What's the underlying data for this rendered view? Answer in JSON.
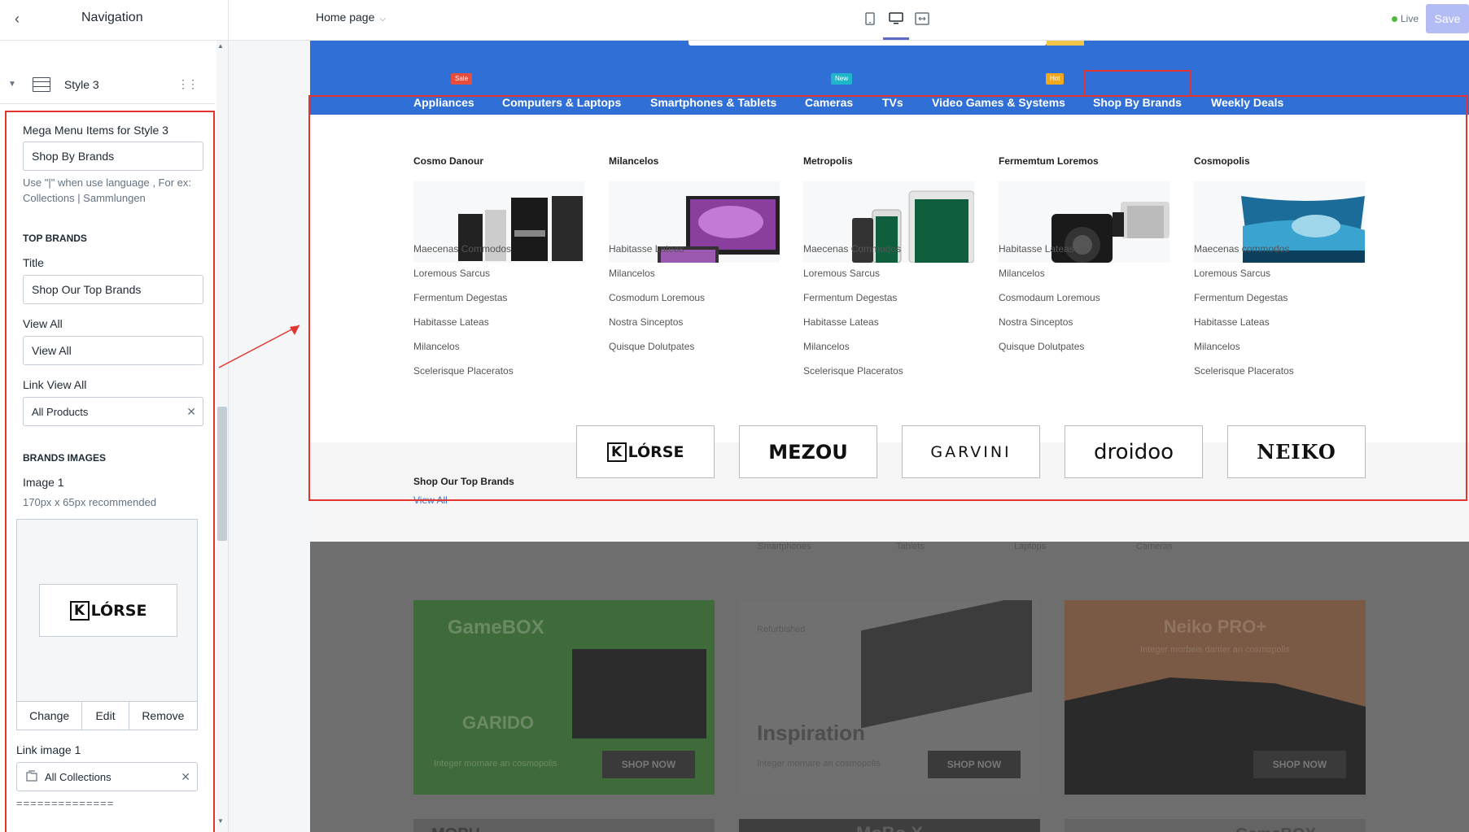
{
  "topbar": {
    "section_title": "Navigation",
    "page_selector": "Home page",
    "live_label": "Live",
    "save_label": "Save"
  },
  "sidebar": {
    "style_label": "Style 3",
    "mega_items_label": "Mega Menu Items for Style 3",
    "mega_items_value": "Shop By Brands",
    "mega_items_help": "Use \"|\" when use language , For ex: Collections | Sammlungen",
    "top_brands_heading": "TOP BRANDS",
    "title_label": "Title",
    "title_value": "Shop Our Top Brands",
    "view_all_label": "View All",
    "view_all_value": "View All",
    "link_view_all_label": "Link View All",
    "link_view_all_value": "All Products",
    "brand_images_heading": "BRANDS IMAGES",
    "image1_label": "Image 1",
    "image1_help": "170px x 65px recommended",
    "image_actions": [
      "Change",
      "Edit",
      "Remove"
    ],
    "link_image1_label": "Link image 1",
    "link_image1_value": "All Collections",
    "separator": "=============="
  },
  "store_nav": {
    "items": [
      "Appliances",
      "Computers & Laptops",
      "Smartphones & Tablets",
      "Cameras",
      "TVs",
      "Video Games & Systems",
      "Shop By Brands",
      "Weekly Deals"
    ],
    "badges": {
      "sale": "Sale",
      "new": "New",
      "hot": "Hot"
    },
    "badge_colors": {
      "sale": "#e74c3c",
      "new": "#1fb6c9",
      "hot": "#f0a81e"
    }
  },
  "mega_menu": {
    "columns": [
      {
        "title": "Cosmo Danour",
        "links": [
          "Maecenas Commodos",
          "Loremous Sarcus",
          "Fermentum Degestas",
          "Habitasse Lateas",
          "Milancelos",
          "Scelerisque Placeratos"
        ]
      },
      {
        "title": "Milancelos",
        "links": [
          "Habitasse Lateas",
          "Milancelos",
          "Cosmodum Loremous",
          "Nostra Sinceptos",
          "Quisque Dolutpates"
        ]
      },
      {
        "title": "Metropolis",
        "links": [
          "Maecenas Commodos",
          "Loremous Sarcus",
          "Fermentum Degestas",
          "Habitasse Lateas",
          "Milancelos",
          "Scelerisque Placeratos"
        ]
      },
      {
        "title": "Fermemtum Loremos",
        "links": [
          "Habitasse Lateas",
          "Milancelos",
          "Cosmodaum Loremous",
          "Nostra Sinceptos",
          "Quisque Dolutpates"
        ]
      },
      {
        "title": "Cosmopolis",
        "links": [
          "Maecenas commodos",
          "Loremous Sarcus",
          "Fermentum Degestas",
          "Habitasse Lateas",
          "Milancelos",
          "Scelerisque Placeratos"
        ]
      }
    ],
    "top_brands_title": "Shop Our Top Brands",
    "view_all": "View All",
    "brands": [
      "KLÓRSE",
      "MEZOU",
      "GARVINI",
      "droidoo",
      "NEIKO"
    ]
  },
  "below": {
    "category_labels": [
      "Smartphones",
      "Tablets",
      "Laptops",
      "Cameras"
    ],
    "banners": [
      {
        "title": "GameBOX",
        "subtitle": "GARIDO",
        "text": "Integer mornare an cosmopolis",
        "button": "SHOP NOW"
      },
      {
        "title": "Inspiration",
        "subtitle": "Refurbished",
        "text": "Integer mornare an cosmopolis",
        "button": "SHOP NOW"
      },
      {
        "title": "Neiko PRO+",
        "subtitle": "Integer morbeis danter an cosmopolis",
        "text": "",
        "button": "SHOP NOW"
      }
    ],
    "row2": [
      "MOPH",
      "MoBo X",
      "GameBOX"
    ]
  }
}
